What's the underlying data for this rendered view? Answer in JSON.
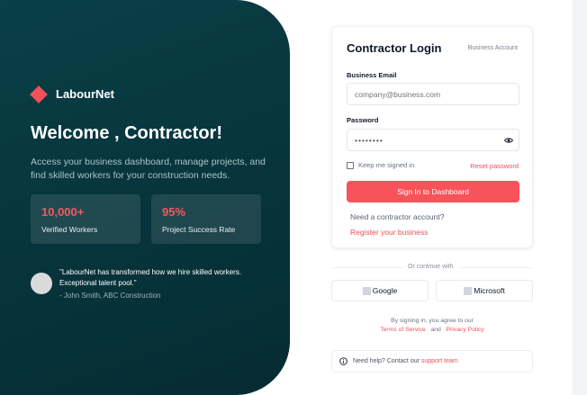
{
  "brand": {
    "name": "LabourNet"
  },
  "hero": {
    "title": "Welcome , Contractor!",
    "description": "Access your business dashboard, manage projects, and find skilled workers for your construction needs."
  },
  "stats": [
    {
      "value": "10,000+",
      "label": "Verified Workers"
    },
    {
      "value": "95%",
      "label": "Project Success Rate"
    }
  ],
  "testimonial": {
    "quote": "\"LabourNet has transformed how we hire skilled workers. Exceptional talent pool.\"",
    "author": "- John Smith, ABC Construction"
  },
  "login": {
    "title": "Contractor Login",
    "account_type": "Business Account",
    "email_label": "Business Email",
    "email_placeholder": "company@business.com",
    "password_label": "Password",
    "password_value": "••••••••",
    "remember_label": "Keep me signed in",
    "reset_label": "Reset password",
    "submit_label": "Sign In to Dashboard",
    "need_account": "Need a contractor account?",
    "register_label": "Register your business"
  },
  "social": {
    "divider": "Or continue with",
    "google": "Google",
    "microsoft": "Microsoft"
  },
  "terms": {
    "prefix": "By signing in, you agree to our",
    "tos": "Terms of Service",
    "and": "and",
    "privacy": "Privacy Policy"
  },
  "help": {
    "text": "Need help? Contact our",
    "link": "support team"
  },
  "colors": {
    "accent": "#f8525a",
    "panel": "#07343c"
  }
}
